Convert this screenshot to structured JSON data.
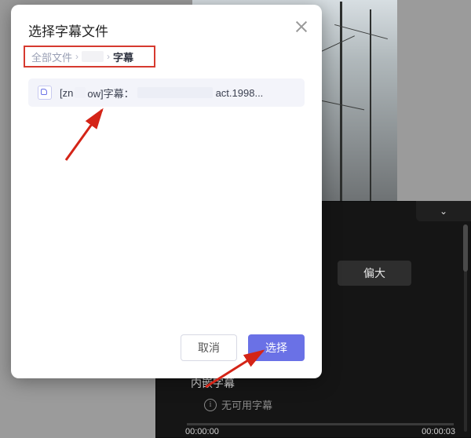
{
  "modal": {
    "title": "选择字幕文件",
    "breadcrumb": {
      "root": "全部文件",
      "sep": "›",
      "leaf": "字幕"
    },
    "file": {
      "prefix": "[zn",
      "mid": "ow]字幕：",
      "suffix": "act.1998..."
    },
    "actions": {
      "cancel": "取消",
      "select": "选择"
    }
  },
  "panel": {
    "size_button": "偏大",
    "embed_label": "内嵌字幕",
    "no_subtitle": "无可用字幕",
    "timeline": {
      "start": "00:00:00",
      "end": "00:00:03"
    },
    "chevron": "⌄"
  }
}
